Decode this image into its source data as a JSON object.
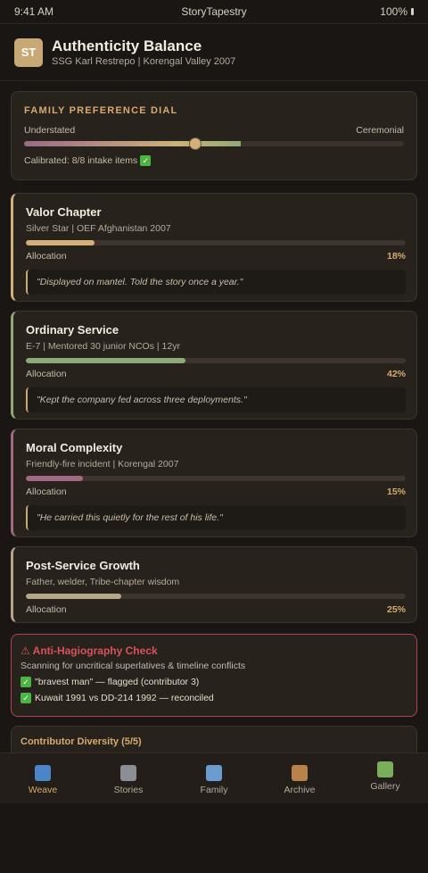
{
  "status": {
    "time": "9:41 AM",
    "app": "StoryTapestry",
    "battery": "100%"
  },
  "header": {
    "avatar": "ST",
    "title": "Authenticity Balance",
    "subtitle": "SSG Karl Restrepo | Korengal Valley 2007"
  },
  "dial": {
    "title": "FAMILY PREFERENCE DIAL",
    "left_label": "Understated",
    "right_label": "Ceremonial",
    "value": 0.45,
    "status": "Calibrated: 8/8 intake items"
  },
  "chapters": [
    {
      "title": "Valor Chapter",
      "subtitle": "Silver Star | OEF Afghanistan 2007",
      "label": "Allocation",
      "percent": "18%",
      "value": 18,
      "color": "#d2b077",
      "quote": "\"Displayed on mantel. Told the story once a year.\""
    },
    {
      "title": "Ordinary Service",
      "subtitle": "E-7 | Mentored 30 junior NCOs | 12yr",
      "label": "Allocation",
      "percent": "42%",
      "value": 42,
      "color": "#8daa78",
      "quote": "\"Kept the company fed across three deployments.\""
    },
    {
      "title": "Moral Complexity",
      "subtitle": "Friendly-fire incident | Korengal 2007",
      "label": "Allocation",
      "percent": "15%",
      "value": 15,
      "color": "#a16a82",
      "quote": "\"He carried this quietly for the rest of his life.\""
    },
    {
      "title": "Post-Service Growth",
      "subtitle": "Father, welder, Tribe-chapter wisdom",
      "label": "Allocation",
      "percent": "25%",
      "value": 25,
      "color": "#b7a58b"
    }
  ],
  "check": {
    "title": "⚠ Anti-Hagiography Check",
    "subtitle": "Scanning for uncritical superlatives & timeline conflicts",
    "items": [
      "\"bravest man\" — flagged (contributor 3)",
      "Kuwait 1991 vs DD-214 1992 — reconciled"
    ]
  },
  "contributors": {
    "title": "Contributor Diversity (5/5)"
  },
  "tabs": [
    {
      "label": "Weave",
      "icon": "spool-icon",
      "color": "#4a86c5",
      "active": true
    },
    {
      "label": "Stories",
      "icon": "book-icon",
      "color": "#8a8f96",
      "active": false
    },
    {
      "label": "Family",
      "icon": "family-icon",
      "color": "#6a9bd1",
      "active": false
    },
    {
      "label": "Archive",
      "icon": "box-icon",
      "color": "#b8824a",
      "active": false
    },
    {
      "label": "Gallery",
      "icon": "picture-icon",
      "color": "#7bae5a",
      "active": false
    }
  ],
  "colors": {
    "accent": "#d4aa70",
    "warning": "#d7525c",
    "background": "#1a1613"
  }
}
